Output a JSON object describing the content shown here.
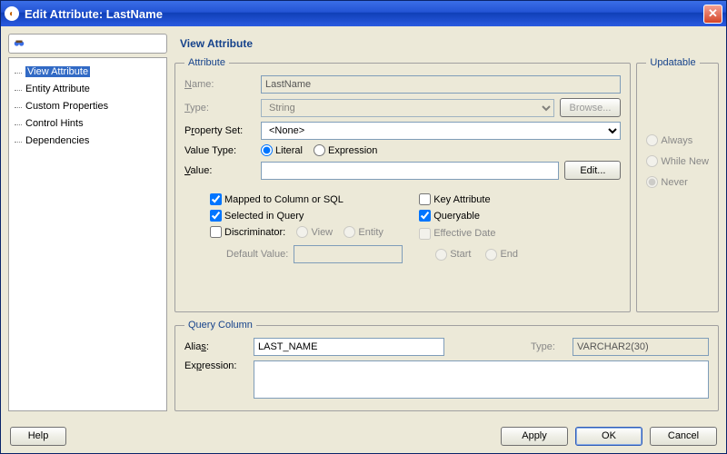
{
  "window": {
    "title": "Edit Attribute: LastName"
  },
  "tree": {
    "items": [
      {
        "label": "View Attribute",
        "selected": true
      },
      {
        "label": "Entity Attribute",
        "selected": false
      },
      {
        "label": "Custom Properties",
        "selected": false
      },
      {
        "label": "Control Hints",
        "selected": false
      },
      {
        "label": "Dependencies",
        "selected": false
      }
    ]
  },
  "section_title": "View Attribute",
  "attribute": {
    "legend": "Attribute",
    "name_label": "Name:",
    "name_value": "LastName",
    "type_label": "Type:",
    "type_value": "String",
    "browse_label": "Browse...",
    "propset_label_pre": "P",
    "propset_label_ul": "r",
    "propset_label_post": "operty Set:",
    "propset_value": "<None>",
    "valtype_label": "Value Type:",
    "valtype_literal": "Literal",
    "valtype_expr": "Expression",
    "value_label_ul": "V",
    "value_label_post": "alue:",
    "value_value": "",
    "edit_label": "Edit...",
    "cb_mapped": "Mapped to Column or SQL",
    "cb_selected": "Selected in Query",
    "cb_discriminator": "Discriminator:",
    "discr_view": "View",
    "discr_entity": "Entity",
    "default_value_label": "Default Value:",
    "cb_key": "Key Attribute",
    "cb_queryable": "Queryable",
    "cb_effdate": "Effective Date",
    "eff_start": "Start",
    "eff_end": "End"
  },
  "updatable": {
    "legend": "Updatable",
    "always": "Always",
    "whilenew": "While New",
    "never": "Never"
  },
  "query": {
    "legend": "Query Column",
    "alias_label": "Alias:",
    "alias_value": "LAST_NAME",
    "type_label": "Type:",
    "type_value": "VARCHAR2(30)",
    "expr_label": "Expression:"
  },
  "footer": {
    "help": "Help",
    "apply": "Apply",
    "ok": "OK",
    "cancel": "Cancel"
  }
}
